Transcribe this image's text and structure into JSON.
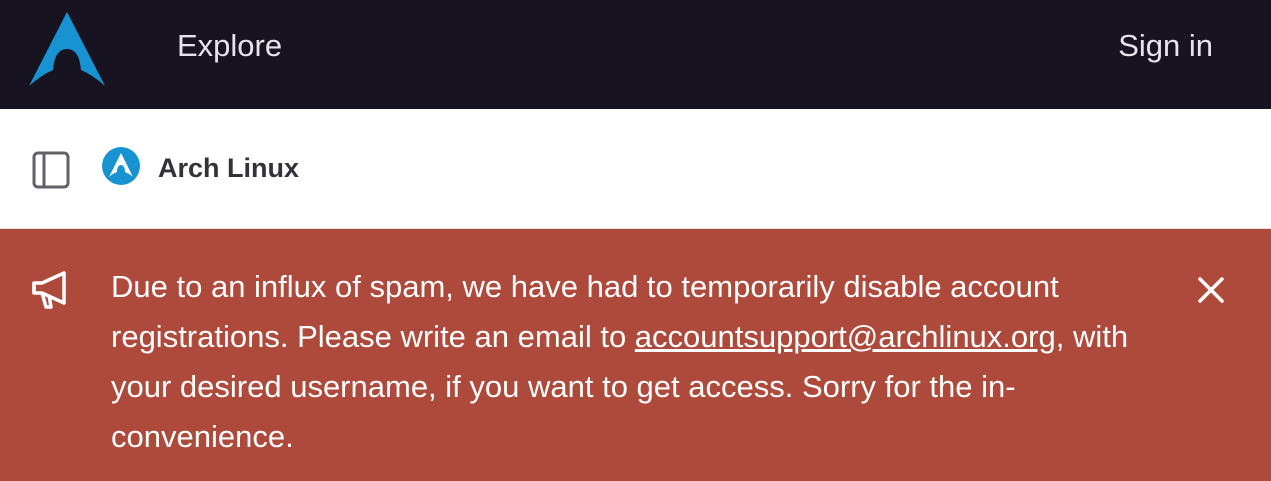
{
  "topbar": {
    "logo_icon": "arch-linux-logo-icon",
    "explore_label": "Explore",
    "signin_label": "Sign in"
  },
  "group": {
    "sidebar_toggle_icon": "sidebar-toggle-icon",
    "avatar_icon": "arch-linux-avatar-icon",
    "name": "Arch Linux"
  },
  "banner": {
    "icon": "megaphone-icon",
    "text_before": "Due to an influx of spam, we have had to temporarily disable account registrations. Please write an email to ",
    "email": "accountsupport@archlinux.org",
    "text_after": ", with your desired username, if you want to get access. Sorry for the in­convenience.",
    "close_icon": "close-icon",
    "background_color": "#ae4a3b"
  },
  "colors": {
    "topbar_bg": "#171321",
    "brand_blue": "#1793d1"
  }
}
